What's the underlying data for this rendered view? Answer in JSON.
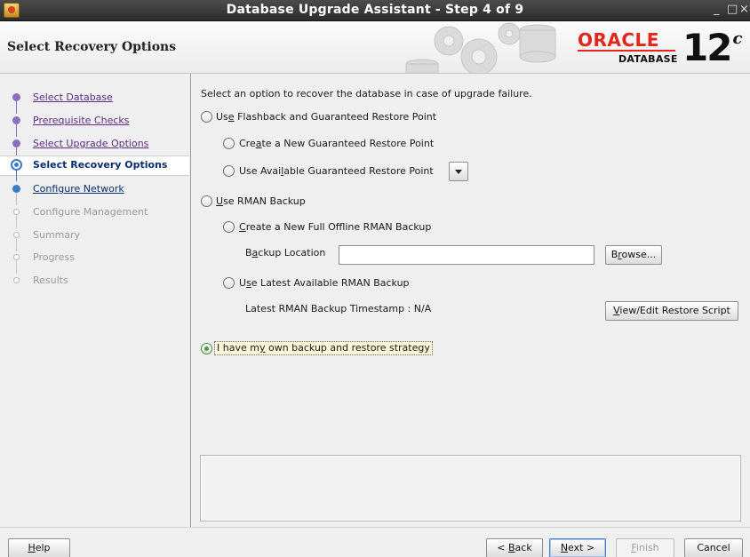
{
  "window": {
    "title": "Database Upgrade Assistant - Step 4 of 9",
    "controls": [
      "_",
      "□",
      "×"
    ]
  },
  "header": {
    "page_title": "Select Recovery Options",
    "logo_word": "ORACLE",
    "logo_sub": "DATABASE",
    "logo_version": "12",
    "logo_version_sup": "c"
  },
  "steps": [
    {
      "label": "Select Database",
      "state": "done"
    },
    {
      "label": "Prerequisite Checks",
      "state": "done"
    },
    {
      "label": "Select Upgrade Options",
      "state": "done"
    },
    {
      "label": "Select Recovery Options",
      "state": "current"
    },
    {
      "label": "Configure Network",
      "state": "next"
    },
    {
      "label": "Configure Management",
      "state": "todo"
    },
    {
      "label": "Summary",
      "state": "todo"
    },
    {
      "label": "Progress",
      "state": "todo"
    },
    {
      "label": "Results",
      "state": "todo"
    }
  ],
  "content": {
    "intro": "Select an option to recover the database in case of upgrade failure.",
    "flashback": {
      "pre": "Us",
      "mn": "e",
      "post": " Flashback and Guaranteed Restore Point",
      "checked": false
    },
    "create_grp": {
      "pre": "Cre",
      "mn": "a",
      "post": "te a New Guaranteed Restore Point",
      "checked": false
    },
    "use_grp": {
      "pre": "Use Avai",
      "mn": "l",
      "post": "able Guaranteed Restore Point",
      "checked": false
    },
    "rman": {
      "pre": "",
      "mn": "U",
      "post": "se RMAN Backup",
      "checked": false
    },
    "create_rman": {
      "pre": "",
      "mn": "C",
      "post": "reate a New Full Offline RMAN Backup",
      "checked": false
    },
    "backup_location": {
      "pre": "B",
      "mn": "a",
      "post": "ckup Location",
      "value": ""
    },
    "browse": {
      "pre": "B",
      "mn": "r",
      "post": "owse..."
    },
    "latest_rman": {
      "pre": "U",
      "mn": "s",
      "post": "e Latest Available RMAN Backup",
      "checked": false
    },
    "timestamp_text": "Latest RMAN Backup Timestamp : N/A",
    "view_edit": {
      "pre": "",
      "mn": "V",
      "post": "iew/Edit Restore Script"
    },
    "own_strategy": {
      "pre": "I have m",
      "mn": "y",
      "post": " own backup and restore strategy",
      "checked": true
    }
  },
  "footer": {
    "help": {
      "pre": "",
      "mn": "H",
      "post": "elp"
    },
    "back": {
      "pre": "< ",
      "mn": "B",
      "post": "ack"
    },
    "next": {
      "pre": "",
      "mn": "N",
      "post": "ext >"
    },
    "finish": {
      "pre": "",
      "mn": "F",
      "post": "inish"
    },
    "cancel": "Cancel"
  }
}
